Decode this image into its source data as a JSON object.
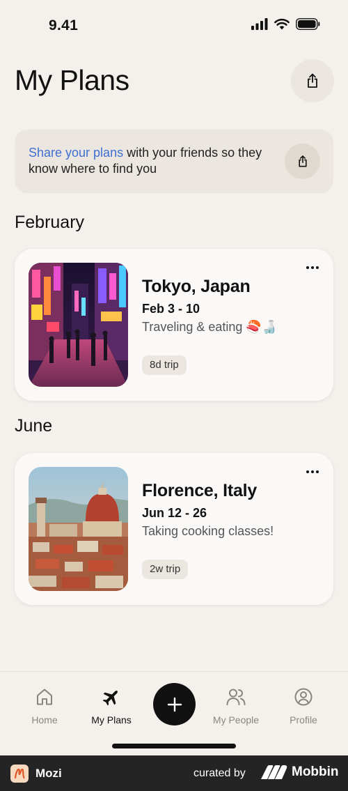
{
  "status_bar": {
    "time": "9.41"
  },
  "header": {
    "title": "My Plans"
  },
  "share_banner": {
    "link_text": "Share your plans",
    "text": " with your friends so they know where to find you"
  },
  "sections": [
    {
      "title": "February",
      "plan": {
        "name": "Tokyo, Japan",
        "dates": "Feb 3 - 10",
        "description": "Traveling & eating 🍣🍶",
        "badge": "8d trip",
        "image": "tokyo-street-photo"
      }
    },
    {
      "title": "June",
      "plan": {
        "name": "Florence, Italy",
        "dates": "Jun 12 - 26",
        "description": "Taking cooking classes!",
        "badge": "2w trip",
        "image": "florence-cathedral-photo"
      }
    }
  ],
  "tab_bar": {
    "tabs": [
      {
        "label": "Home",
        "icon": "home-icon",
        "active": false
      },
      {
        "label": "My Plans",
        "icon": "airplane-icon",
        "active": true
      },
      {
        "label": "My People",
        "icon": "people-icon",
        "active": false
      },
      {
        "label": "Profile",
        "icon": "profile-icon",
        "active": false
      }
    ],
    "add_icon": "plus-icon"
  },
  "footer": {
    "app_name": "Mozi",
    "curated_by": "curated by",
    "brand": "Mobbin"
  },
  "colors": {
    "background": "#f4f1ed",
    "card": "#fbf9f7",
    "accent_link": "#3f6fd1",
    "primary": "#111111",
    "footer": "#242424"
  }
}
